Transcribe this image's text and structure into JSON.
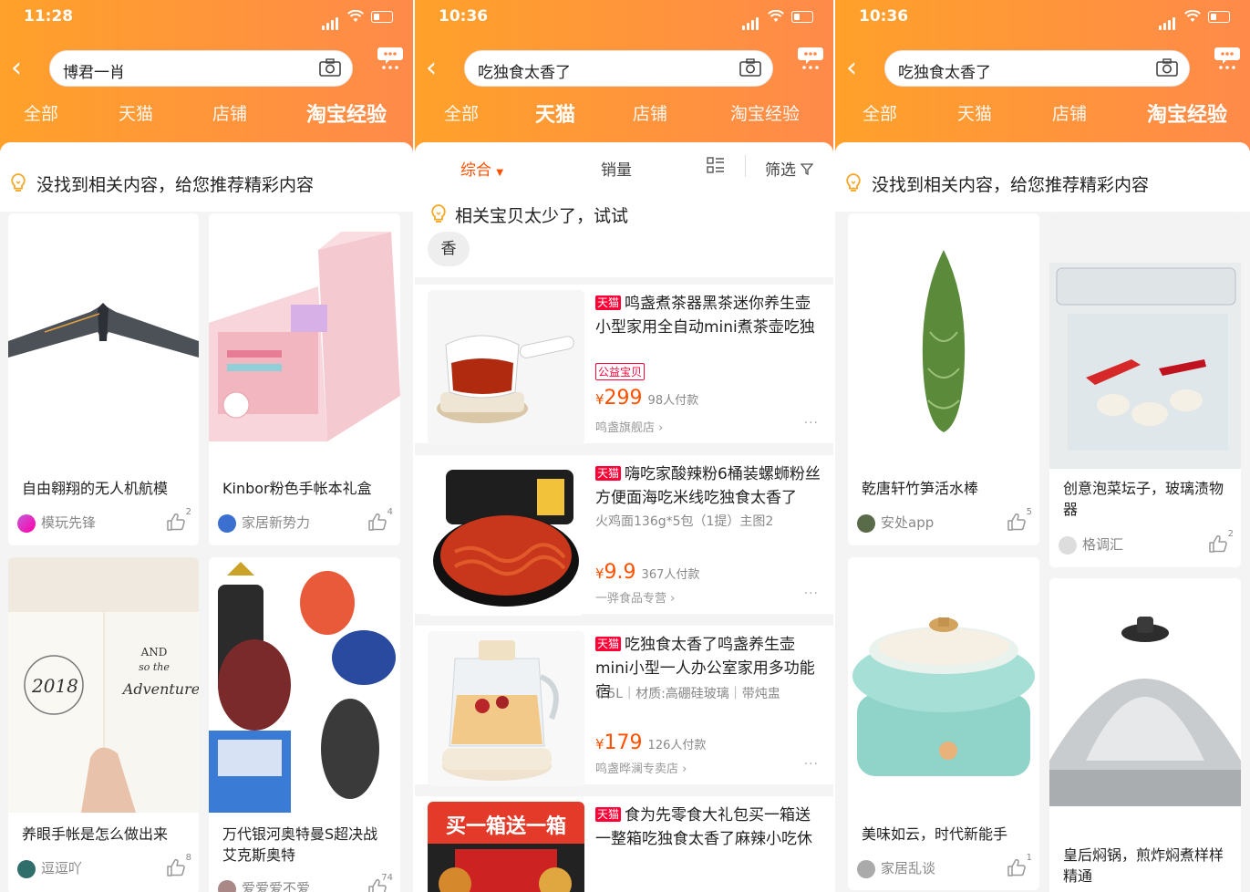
{
  "colors": {
    "header_start": "#ffa12a",
    "header_end": "#ff8a4a",
    "accent": "#ff5000",
    "tmall_red": "#ff0036"
  },
  "panel1": {
    "status_time": "11:28",
    "search_query": "博君一肖",
    "tabs": [
      "全部",
      "天猫",
      "店铺",
      "淘宝经验"
    ],
    "notice": "没找到相关内容，给您推荐精彩内容",
    "cards": [
      {
        "title": "自由翱翔的无人机航模",
        "source": "模玩先锋",
        "likes": "2"
      },
      {
        "title": "Kinbor粉色手帐本礼盒",
        "source": "家居新势力",
        "likes": "4"
      },
      {
        "title": "养眼手帐是怎么做出来",
        "source": "逗逗吖",
        "likes": "8"
      },
      {
        "title": "万代银河奥特曼S超决战艾克斯奥特",
        "source": "爱爱爱不爱",
        "likes": "74"
      }
    ],
    "journal_text": {
      "year": "2018",
      "line": "AND so the Adventure"
    }
  },
  "panel2": {
    "status_time": "10:36",
    "search_query": "吃独食太香了",
    "tabs": [
      "全部",
      "天猫",
      "店铺",
      "淘宝经验"
    ],
    "sort": {
      "comprehensive": "综合",
      "sales": "销量",
      "filter": "筛选"
    },
    "tip": "相关宝贝太少了，试试",
    "suggest_chip": "香",
    "tmall_badge": "天猫",
    "items": [
      {
        "name": "鸣盏煮茶器黑茶迷你养生壶小型家用全自动mini煮茶壶吃独",
        "sub": "",
        "tag": "公益宝贝",
        "currency": "¥",
        "price": "299",
        "sold": "98人付款",
        "shop": "鸣盏旗舰店"
      },
      {
        "name": "嗨吃家酸辣粉6桶装螺蛳粉丝方便面海吃米线吃独食太香了",
        "sub": "火鸡面136g*5包（1提）主图2",
        "tag": "",
        "currency": "¥",
        "price": "9.9",
        "sold": "367人付款",
        "shop": "一骅食品专营"
      },
      {
        "name": "吃独食太香了鸣盏养生壶mini小型一人办公室家用多功能宿",
        "sub": "0.5L｜材质:高硼硅玻璃｜带炖盅",
        "tag": "",
        "currency": "¥",
        "price": "179",
        "sold": "126人付款",
        "shop": "鸣盏晔澜专卖店"
      },
      {
        "name": "食为先零食大礼包买一箱送一整箱吃独食太香了麻辣小吃休",
        "sub": "",
        "tag": "",
        "currency": "",
        "price": "",
        "sold": "",
        "shop": ""
      }
    ],
    "box_text": "买一箱送一箱"
  },
  "panel3": {
    "status_time": "10:36",
    "search_query": "吃独食太香了",
    "tabs": [
      "全部",
      "天猫",
      "店铺",
      "淘宝经验"
    ],
    "notice": "没找到相关内容，给您推荐精彩内容",
    "cards": [
      {
        "title": "乾唐轩竹笋活水棒",
        "source": "安处app",
        "likes": "5"
      },
      {
        "title": "创意泡菜坛子，玻璃渍物器",
        "source": "格调汇",
        "likes": "2"
      },
      {
        "title": "美味如云，时代新能手",
        "source": "家居乱谈",
        "likes": "1"
      },
      {
        "title": "皇后焖锅，煎炸焖煮样样精通",
        "source": "",
        "likes": ""
      }
    ]
  }
}
